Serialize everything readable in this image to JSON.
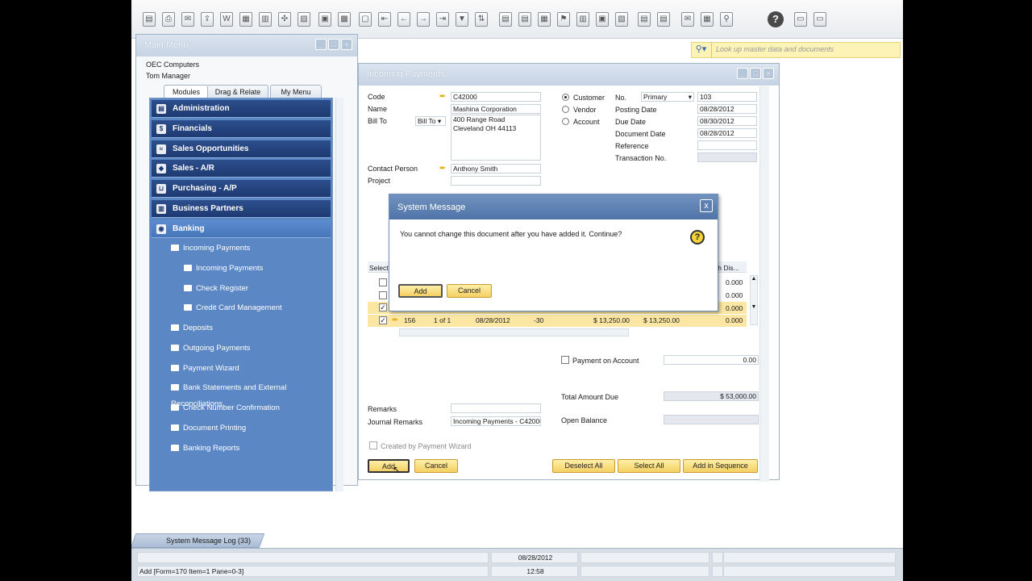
{
  "search": {
    "placeholder": "Look up master data and documents"
  },
  "main_menu": {
    "title": "Main Menu",
    "company": "OEC Computers",
    "user": "Tom Manager",
    "tabs": [
      "Modules",
      "Drag & Relate",
      "My Menu"
    ],
    "modules": [
      "Administration",
      "Financials",
      "Sales Opportunities",
      "Sales - A/R",
      "Purchasing - A/P",
      "Business Partners",
      "Banking"
    ],
    "banking_items": [
      "Incoming Payments",
      "Incoming Payments",
      "Check Register",
      "Credit Card Management",
      "Deposits",
      "Outgoing Payments",
      "Payment Wizard",
      "Bank Statements and External Reconciliations",
      "Check Number Confirmation",
      "Document Printing",
      "Banking Reports"
    ]
  },
  "incoming_payments": {
    "title": "Incoming Payments",
    "labels": {
      "code": "Code",
      "name": "Name",
      "bill_to": "Bill To",
      "contact": "Contact Person",
      "project": "Project",
      "remarks": "Remarks",
      "journal": "Journal Remarks"
    },
    "values": {
      "code": "C42000",
      "name": "Mashina Corporation",
      "bill_to_select": "Bill To",
      "address_1": "400 Range Road",
      "address_2": "Cleveland OH  44113",
      "contact": "Anthony Smith",
      "journal": "Incoming Payments - C42000"
    },
    "radios": {
      "customer": "Customer",
      "vendor": "Vendor",
      "account": "Account"
    },
    "right_labels": {
      "no": "No.",
      "posting": "Posting Date",
      "due": "Due Date",
      "docdate": "Document Date",
      "reference": "Reference",
      "transaction": "Transaction No."
    },
    "right_values": {
      "series": "Primary",
      "no": "103",
      "posting": "08/28/2012",
      "due": "08/30/2012",
      "docdate": "08/28/2012"
    },
    "table": {
      "col_select": "Select",
      "col_cash": "sh Dis...",
      "cash_values": [
        "0.000",
        "0.000",
        "0.000"
      ],
      "last_row": {
        "doc": "156",
        "installment": "1 of 1",
        "date": "08/28/2012",
        "overdue": "-30",
        "total": "$ 13,250.00",
        "balance": "$ 13,250.00",
        "cash": "0.000"
      }
    },
    "payment_on_account": "Payment on Account",
    "payment_on_account_value": "0.00",
    "total_due_label": "Total Amount Due",
    "total_due_value": "$ 53,000.00",
    "open_balance_label": "Open Balance",
    "created_by_wizard": "Created by Payment Wizard",
    "buttons": {
      "add": "Add",
      "cancel": "Cancel",
      "deselect_all": "Deselect All",
      "select_all": "Select All",
      "add_in_sequence": "Add in Sequence"
    }
  },
  "dialog": {
    "title": "System Message",
    "message": "You cannot change this document after you have added it. Continue?",
    "add": "Add",
    "cancel": "Cancel",
    "close": "x"
  },
  "status": {
    "log_tab": "System Message Log (33)",
    "date": "08/28/2012",
    "time": "12:58",
    "info": "Add [Form=170 Item=1 Pane=0-3]"
  }
}
